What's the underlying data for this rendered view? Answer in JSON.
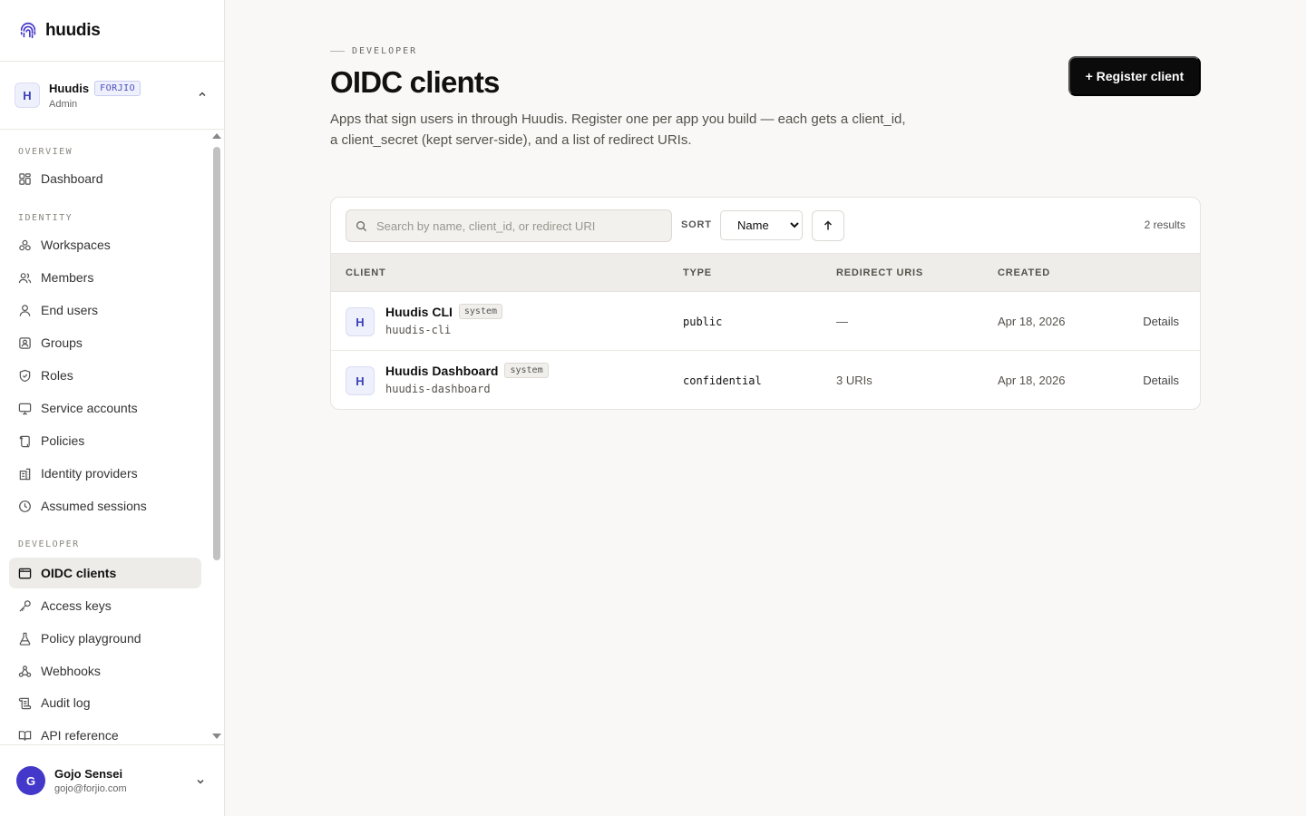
{
  "brand": {
    "name": "huudis"
  },
  "org": {
    "initial": "H",
    "name": "Huudis",
    "badge": "FORJIO",
    "role": "Admin"
  },
  "nav": {
    "overview_label": "OVERVIEW",
    "dashboard": "Dashboard",
    "identity_label": "IDENTITY",
    "workspaces": "Workspaces",
    "members": "Members",
    "end_users": "End users",
    "groups": "Groups",
    "roles": "Roles",
    "service_accounts": "Service accounts",
    "policies": "Policies",
    "identity_providers": "Identity providers",
    "assumed_sessions": "Assumed sessions",
    "developer_label": "DEVELOPER",
    "oidc_clients": "OIDC clients",
    "access_keys": "Access keys",
    "policy_playground": "Policy playground",
    "webhooks": "Webhooks",
    "audit_log": "Audit log",
    "api_reference": "API reference"
  },
  "user": {
    "initial": "G",
    "name": "Gojo Sensei",
    "email": "gojo@forjio.com"
  },
  "page": {
    "eyebrow": "DEVELOPER",
    "title": "OIDC clients",
    "description": "Apps that sign users in through Huudis. Register one per app you build — each gets a client_id, a client_secret (kept server-side), and a list of redirect URIs.",
    "register_button": "+ Register client"
  },
  "toolbar": {
    "search_placeholder": "Search by name, client_id, or redirect URI",
    "sort_label": "SORT",
    "sort_value": "Name",
    "sort_options": [
      "Name"
    ],
    "results": "2 results"
  },
  "table": {
    "headers": {
      "client": "CLIENT",
      "type": "TYPE",
      "redirect": "REDIRECT URIS",
      "created": "CREATED"
    },
    "rows": [
      {
        "initial": "H",
        "name": "Huudis CLI",
        "badge": "system",
        "client_id": "huudis-cli",
        "type": "public",
        "redirect": "—",
        "created": "Apr 18, 2026",
        "action": "Details"
      },
      {
        "initial": "H",
        "name": "Huudis Dashboard",
        "badge": "system",
        "client_id": "huudis-dashboard",
        "type": "confidential",
        "redirect": "3 URIs",
        "created": "Apr 18, 2026",
        "action": "Details"
      }
    ]
  },
  "colors": {
    "accent": "#4338ca",
    "primary_button": "#0b0b0b",
    "background": "#f9f8f6"
  }
}
